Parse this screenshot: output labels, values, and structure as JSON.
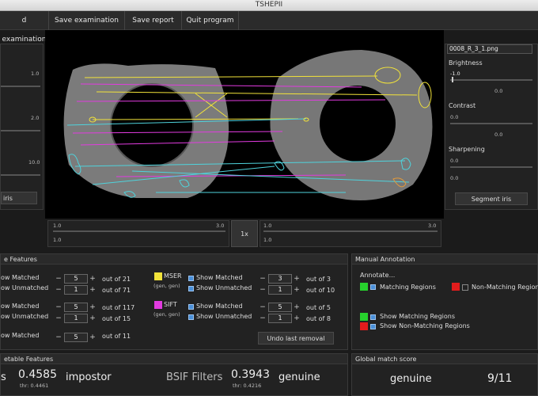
{
  "window": {
    "title": "TSHEPII"
  },
  "menu": {
    "load": "d examination",
    "save_exam": "Save examination",
    "save_report": "Save report",
    "quit": "Quit program"
  },
  "left_panel": {
    "ticks": [
      "1.0",
      "2.0",
      "10.0"
    ],
    "segment_button": "iris"
  },
  "right_panel": {
    "filename": "0008_R_3_1.png",
    "brightness_label": "Brightness",
    "brightness_min": "-1.0",
    "brightness_mid": "0.0",
    "contrast_label": "Contrast",
    "contrast_min": "0.0",
    "contrast_mid": "0.0",
    "sharpening_label": "Sharpening",
    "sharpening_min": "0.0",
    "sharpening_mid": "0.0",
    "segment_button": "Segment iris"
  },
  "zoom_bar": {
    "left_min": "1.0",
    "left_max": "3.0",
    "left_value": "1.0",
    "zoom_button": "1x",
    "right_min": "1.0",
    "right_max": "3.0",
    "right_value": "1.0"
  },
  "features": {
    "title": "e Features",
    "rows": [
      {
        "label1": "ow Matched",
        "value1": "5",
        "out1": "out of 21",
        "label2": "ow Unmatched",
        "value2": "1",
        "out2": "out of 71"
      },
      {
        "label1": "ow Matched",
        "value1": "5",
        "out1": "out of 117",
        "label2": "ow Unmatched",
        "value2": "1",
        "out2": "out of 15"
      },
      {
        "label1": "ow Matched",
        "value1": "5",
        "out1": "out of 11"
      }
    ],
    "mser": {
      "name": "MSER",
      "sub": "(gen, gen)",
      "color": "#f2e33a",
      "show_matched": "Show Matched",
      "show_unmatched": "Show Unmatched",
      "value1": "3",
      "out1": "out of 3",
      "value2": "1",
      "out2": "out of 10"
    },
    "sift": {
      "name": "SIFT",
      "sub": "(gen, gen)",
      "color": "#e23be0",
      "show_matched": "Show Matched",
      "show_unmatched": "Show Unmatched",
      "value1": "5",
      "out1": "out of 5",
      "value2": "1",
      "out2": "out of 8"
    },
    "undo_button": "Undo last removal"
  },
  "manual_annotation": {
    "title": "Manual Annotation",
    "annotate": "Annotate...",
    "matching": "Matching Regions",
    "non_matching": "Non-Matching Regions",
    "show_matching": "Show Matching Regions",
    "show_non_matching": "Show Non-Matching Regions",
    "green": "#27d12d",
    "red": "#e21c1c"
  },
  "interpretable": {
    "title": "etable Features",
    "left_label": "s",
    "left_score": "0.4585",
    "left_thr": "thr: 0.4461",
    "left_verdict": "impostor",
    "bsif_label": "BSIF Filters",
    "bsif_score": "0.3943",
    "bsif_thr": "thr: 0.4216",
    "bsif_verdict": "genuine"
  },
  "global": {
    "title": "Global match score",
    "verdict": "genuine",
    "score": "9/11"
  }
}
